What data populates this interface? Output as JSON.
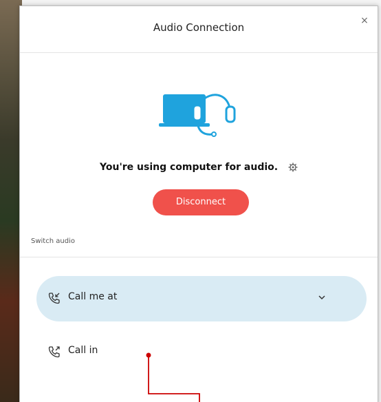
{
  "dialog": {
    "title": "Audio Connection",
    "close_glyph": "×"
  },
  "status": {
    "text": "You're using computer for audio.",
    "icon": "gear-icon"
  },
  "actions": {
    "disconnect_label": "Disconnect"
  },
  "switch_audio": {
    "label": "Switch audio",
    "options": [
      {
        "label": "Call me at",
        "icon": "phone-incoming-icon",
        "selected": true
      },
      {
        "label": "Call in",
        "icon": "phone-outgoing-icon",
        "selected": false
      }
    ]
  },
  "colors": {
    "accent_red": "#f0514b",
    "illustration_blue": "#1fa3dd",
    "selected_bg": "#d9ebf4",
    "annotation_red": "#cc0000"
  }
}
